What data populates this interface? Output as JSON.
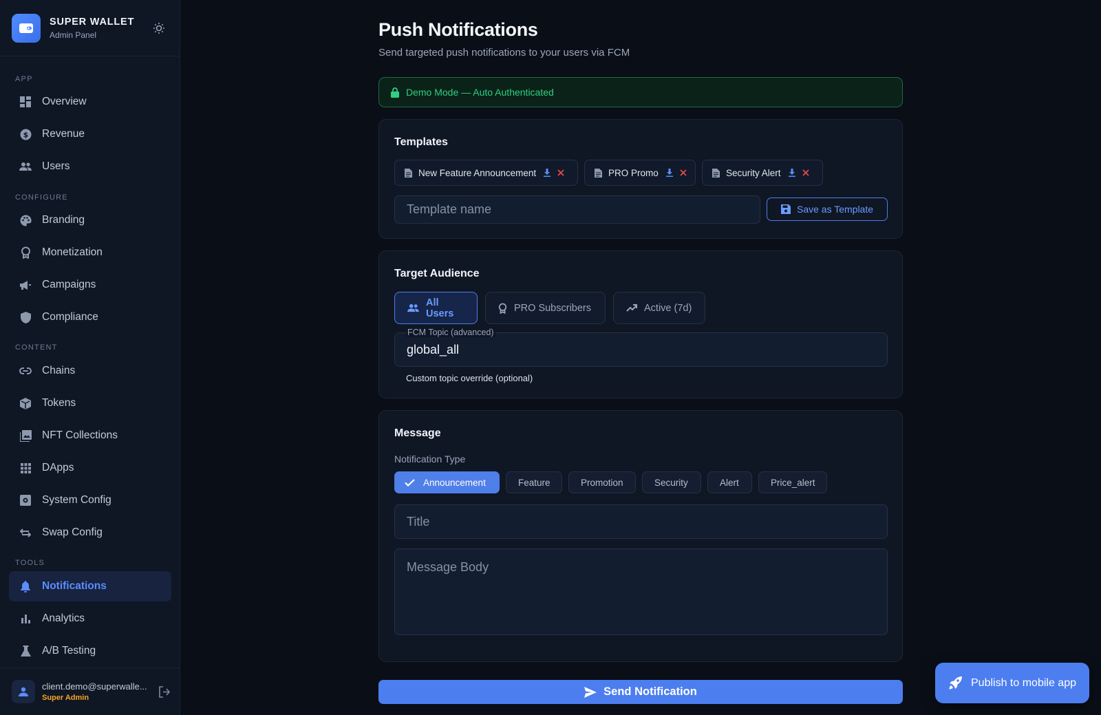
{
  "brand": {
    "title": "SUPER WALLET",
    "subtitle": "Admin Panel"
  },
  "sidebar": {
    "sections": [
      "APP",
      "CONFIGURE",
      "CONTENT",
      "TOOLS"
    ],
    "items": [
      {
        "label": "Overview",
        "icon": "dashboard-icon"
      },
      {
        "label": "Revenue",
        "icon": "dollar-icon"
      },
      {
        "label": "Users",
        "icon": "users-icon"
      },
      {
        "label": "Branding",
        "icon": "palette-icon"
      },
      {
        "label": "Monetization",
        "icon": "badge-icon"
      },
      {
        "label": "Campaigns",
        "icon": "megaphone-icon"
      },
      {
        "label": "Compliance",
        "icon": "shield-icon"
      },
      {
        "label": "Chains",
        "icon": "link-icon"
      },
      {
        "label": "Tokens",
        "icon": "cube-icon"
      },
      {
        "label": "NFT Collections",
        "icon": "images-icon"
      },
      {
        "label": "DApps",
        "icon": "grid-icon"
      },
      {
        "label": "System Config",
        "icon": "settings-icon"
      },
      {
        "label": "Swap Config",
        "icon": "swap-icon"
      },
      {
        "label": "Notifications",
        "icon": "bell-icon",
        "active": true
      },
      {
        "label": "Analytics",
        "icon": "bar-chart-icon"
      },
      {
        "label": "A/B Testing",
        "icon": "flask-icon"
      }
    ],
    "user": {
      "email": "client.demo@superwalle...",
      "role": "Super Admin"
    }
  },
  "page": {
    "title": "Push Notifications",
    "subtitle": "Send targeted push notifications to your users via FCM",
    "demo_banner": "Demo Mode — Auto Authenticated"
  },
  "templates": {
    "title": "Templates",
    "items": [
      "New Feature Announcement",
      "PRO Promo",
      "Security Alert"
    ],
    "name_placeholder": "Template name",
    "save_label": "Save as Template"
  },
  "audience": {
    "title": "Target Audience",
    "options": [
      "All Users",
      "PRO Subscribers",
      "Active (7d)"
    ],
    "selected": "All Users",
    "fcm_label": "FCM Topic (advanced)",
    "fcm_value": "global_all",
    "fcm_helper": "Custom topic override (optional)"
  },
  "message": {
    "title": "Message",
    "type_label": "Notification Type",
    "types": [
      "Announcement",
      "Feature",
      "Promotion",
      "Security",
      "Alert",
      "Price_alert"
    ],
    "selected_type": "Announcement",
    "title_placeholder": "Title",
    "body_placeholder": "Message Body"
  },
  "actions": {
    "send": "Send Notification",
    "publish": "Publish to mobile app"
  },
  "colors": {
    "accent": "#4c7ef0",
    "background": "#0a0e16",
    "surface": "#0f1624",
    "success": "#2fd081",
    "danger": "#e5484d",
    "role": "#f5a623"
  }
}
